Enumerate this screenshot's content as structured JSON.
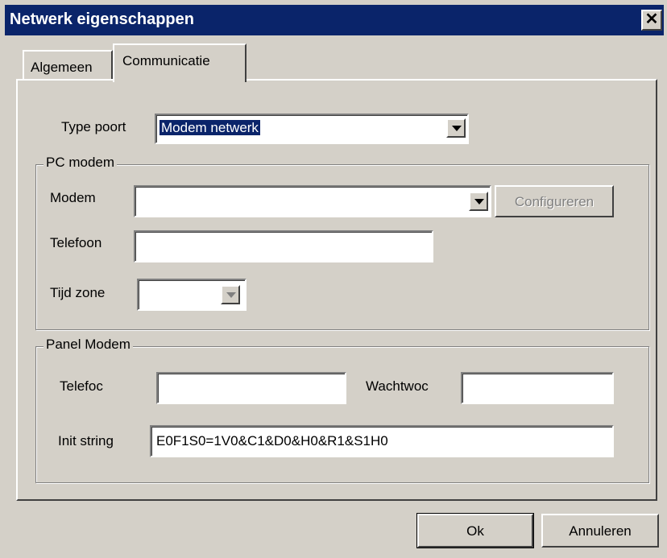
{
  "window": {
    "title": "Netwerk eigenschappen",
    "close_glyph": "✕"
  },
  "tabs": [
    {
      "label": "Algemeen",
      "active": false
    },
    {
      "label": "Communicatie",
      "active": true
    }
  ],
  "port": {
    "label": "Type poort",
    "value": "Modem netwerk"
  },
  "pc_modem": {
    "group_label": "PC modem",
    "modem_label": "Modem",
    "modem_value": "",
    "configure_button": "Configureren",
    "phone_label": "Telefoon",
    "phone_value": "",
    "timezone_label": "Tijd zone",
    "timezone_value": ""
  },
  "panel_modem": {
    "group_label": "Panel Modem",
    "phone_label": "Telefoc",
    "phone_value": "",
    "password_label": "Wachtwoc",
    "password_value": "",
    "init_label": "Init string",
    "init_value": "E0F1S0=1V0&C1&D0&H0&R1&S1H0"
  },
  "footer": {
    "ok_button": "Ok",
    "cancel_button": "Annuleren"
  }
}
